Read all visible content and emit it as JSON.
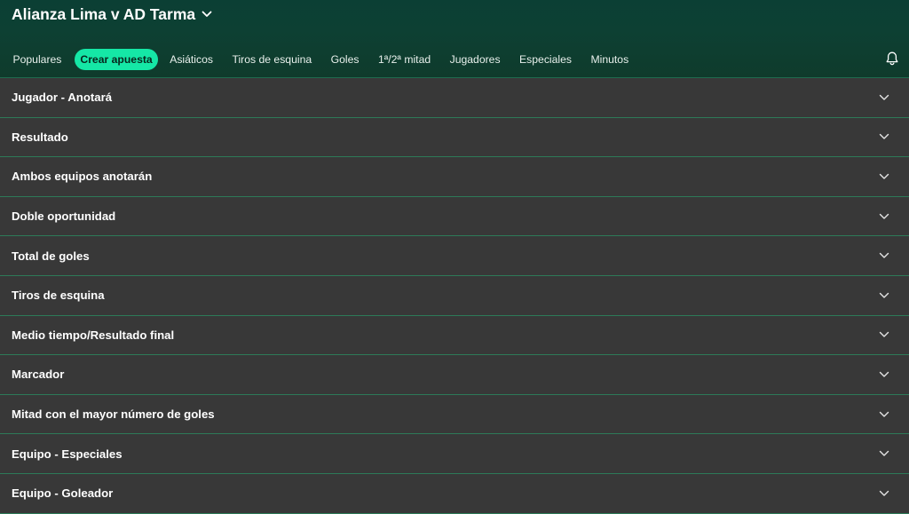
{
  "header": {
    "match_title": "Alianza Lima v AD Tarma",
    "tabs": [
      {
        "label": "Populares",
        "active": false
      },
      {
        "label": "Crear apuesta",
        "active": true
      },
      {
        "label": "Asiáticos",
        "active": false
      },
      {
        "label": "Tiros de esquina",
        "active": false
      },
      {
        "label": "Goles",
        "active": false
      },
      {
        "label": "1ª/2ª mitad",
        "active": false
      },
      {
        "label": "Jugadores",
        "active": false
      },
      {
        "label": "Especiales",
        "active": false
      },
      {
        "label": "Minutos",
        "active": false
      }
    ],
    "icons": {
      "title_dropdown": "chevron-down-icon",
      "notifications": "bell-icon"
    }
  },
  "markets": [
    {
      "label": "Jugador - Anotará"
    },
    {
      "label": "Resultado"
    },
    {
      "label": "Ambos equipos anotarán"
    },
    {
      "label": "Doble oportunidad"
    },
    {
      "label": "Total de goles"
    },
    {
      "label": "Tiros de esquina"
    },
    {
      "label": "Medio tiempo/Resultado final"
    },
    {
      "label": "Marcador"
    },
    {
      "label": "Mitad con el mayor número de goles"
    },
    {
      "label": "Equipo - Especiales"
    },
    {
      "label": "Equipo - Goleador"
    }
  ],
  "colors": {
    "header_bg": "#0d4033",
    "accent": "#15e7a6",
    "row_bg": "#383838",
    "row_divider": "#2d7a58",
    "text": "#ffffff"
  }
}
